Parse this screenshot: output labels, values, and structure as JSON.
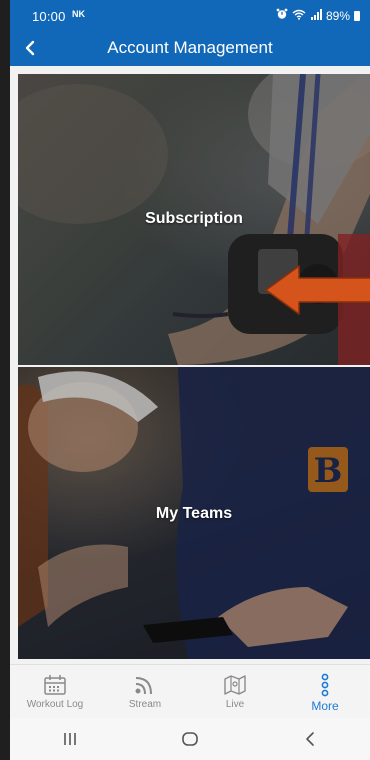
{
  "status_bar": {
    "time": "10:00",
    "carrier_badge": "NK",
    "battery": "89%"
  },
  "header": {
    "title": "Account Management"
  },
  "cards": [
    {
      "label": "Subscription"
    },
    {
      "label": "My Teams"
    }
  ],
  "bottom_nav": [
    {
      "label": "Workout Log",
      "icon": "calendar-icon"
    },
    {
      "label": "Stream",
      "icon": "stream-icon"
    },
    {
      "label": "Live",
      "icon": "map-icon"
    },
    {
      "label": "More",
      "icon": "more-dots-icon",
      "active": true
    }
  ],
  "colors": {
    "header_bg": "#1268b8",
    "accent": "#1e7ad6",
    "arrow": "#d4541c"
  }
}
